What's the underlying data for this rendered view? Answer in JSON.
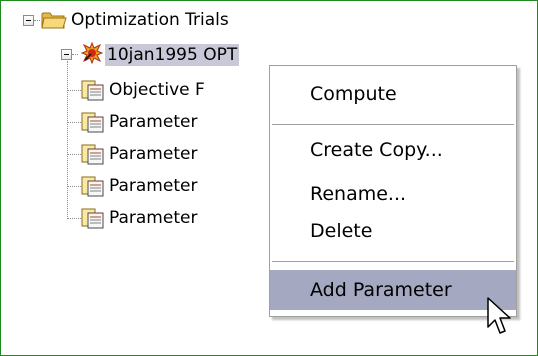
{
  "tree": {
    "root": {
      "label": "Optimization Trials",
      "icon": "folder-icon",
      "expanded": true
    },
    "trial": {
      "label": "10jan1995 OPT",
      "icon": "optimization-trial-icon",
      "expanded": true,
      "selected": true
    },
    "children": [
      {
        "label": "Objective F",
        "icon": "document-icon"
      },
      {
        "label": "Parameter",
        "icon": "document-icon"
      },
      {
        "label": "Parameter",
        "icon": "document-icon"
      },
      {
        "label": "Parameter",
        "icon": "document-icon"
      },
      {
        "label": "Parameter",
        "icon": "document-icon"
      }
    ]
  },
  "context_menu": {
    "items": [
      {
        "label": "Compute"
      },
      {
        "label": "Create Copy..."
      },
      {
        "label": "Rename..."
      },
      {
        "label": "Delete"
      },
      {
        "label": "Add Parameter",
        "highlighted": true
      }
    ]
  },
  "colors": {
    "frame_border": "#1f8a1f",
    "selection": "#c8c8d8",
    "menu_highlight": "#a4a8c0"
  }
}
